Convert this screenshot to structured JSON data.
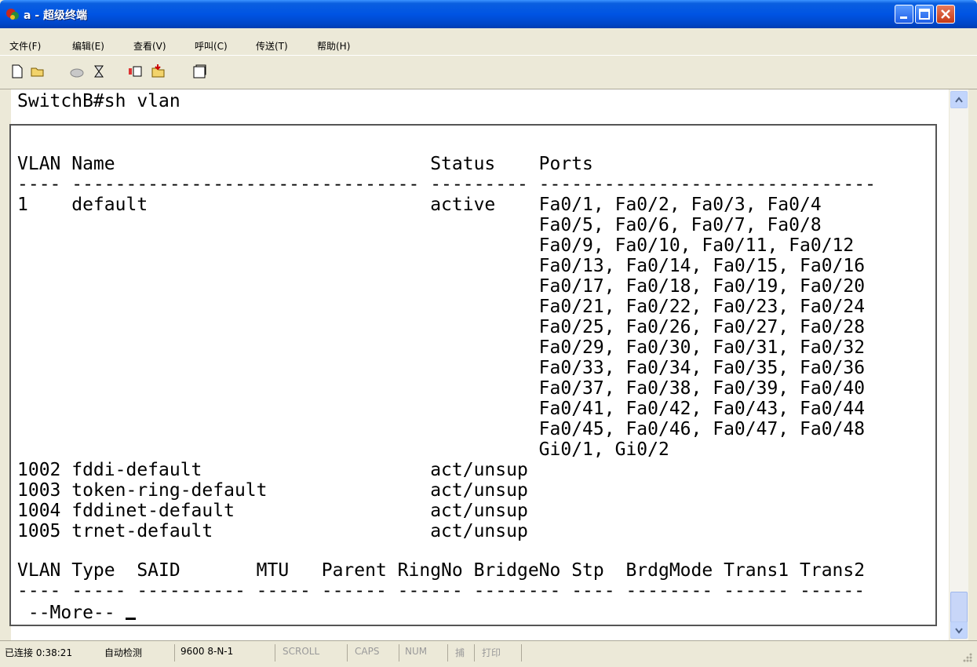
{
  "window": {
    "title": "a - 超级终端"
  },
  "menu": {
    "items": [
      "文件(F)",
      "编辑(E)",
      "查看(V)",
      "呼叫(C)",
      "传送(T)",
      "帮助(H)"
    ]
  },
  "toolbar": {
    "icons": [
      "new-icon",
      "open-icon",
      "disconnect-icon",
      "dial-icon",
      "send-icon",
      "receive-icon",
      "properties-icon"
    ]
  },
  "terminal": {
    "command_line": "SwitchB#sh vlan",
    "lines": [
      "VLAN Name                             Status    Ports",
      "---- -------------------------------- --------- -------------------------------",
      "1    default                          active    Fa0/1, Fa0/2, Fa0/3, Fa0/4",
      "                                                Fa0/5, Fa0/6, Fa0/7, Fa0/8",
      "                                                Fa0/9, Fa0/10, Fa0/11, Fa0/12",
      "                                                Fa0/13, Fa0/14, Fa0/15, Fa0/16",
      "                                                Fa0/17, Fa0/18, Fa0/19, Fa0/20",
      "                                                Fa0/21, Fa0/22, Fa0/23, Fa0/24",
      "                                                Fa0/25, Fa0/26, Fa0/27, Fa0/28",
      "                                                Fa0/29, Fa0/30, Fa0/31, Fa0/32",
      "                                                Fa0/33, Fa0/34, Fa0/35, Fa0/36",
      "                                                Fa0/37, Fa0/38, Fa0/39, Fa0/40",
      "                                                Fa0/41, Fa0/42, Fa0/43, Fa0/44",
      "                                                Fa0/45, Fa0/46, Fa0/47, Fa0/48",
      "                                                Gi0/1, Gi0/2",
      "1002 fddi-default                     act/unsup",
      "1003 token-ring-default               act/unsup",
      "1004 fddinet-default                  act/unsup",
      "1005 trnet-default                    act/unsup",
      "",
      "VLAN Type  SAID       MTU   Parent RingNo BridgeNo Stp  BrdgMode Trans1 Trans2",
      "---- ----- ---------- ----- ------ ------ -------- ---- -------- ------ ------"
    ],
    "more_prompt": " --More-- "
  },
  "status": {
    "connection": "已连接 0:38:21",
    "detect": "自动检测",
    "port_settings": "9600 8-N-1",
    "scroll": "SCROLL",
    "caps": "CAPS",
    "num": "NUM",
    "capture": "捕",
    "print": "打印"
  }
}
